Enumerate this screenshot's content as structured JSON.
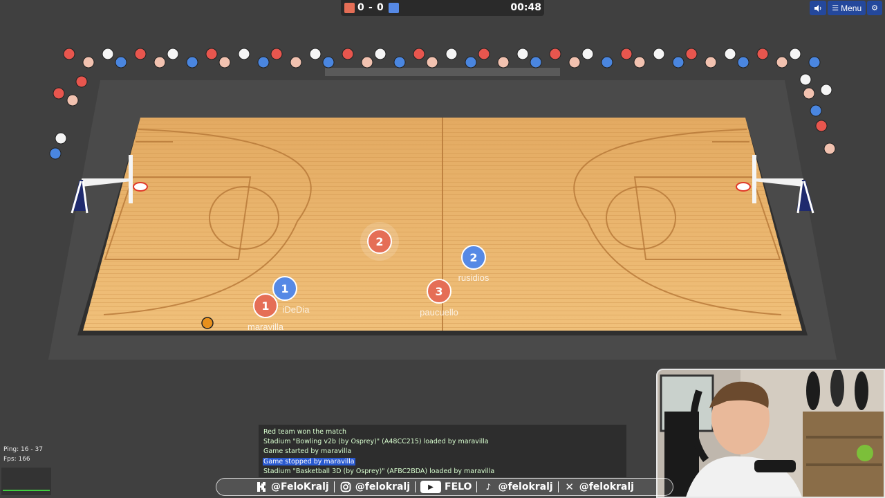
{
  "score": {
    "red": "0",
    "separator": "-",
    "blue": "0",
    "timer": "00:48"
  },
  "colors": {
    "red_team": "#e56e56",
    "blue_team": "#5689e5",
    "court": "#dfa45c",
    "chat_highlight": "#2a5ad0"
  },
  "toolbar": {
    "sound_icon": "speaker-icon",
    "menu_label": "Menu",
    "settings_icon": "gear-icon"
  },
  "players": [
    {
      "number": "2",
      "team": "red",
      "name": ""
    },
    {
      "number": "2",
      "team": "blue",
      "name": "rusidios"
    },
    {
      "number": "1",
      "team": "blue",
      "name": "iDeDia"
    },
    {
      "number": "1",
      "team": "red",
      "name": "maravilla"
    },
    {
      "number": "3",
      "team": "red",
      "name": "paucuello"
    }
  ],
  "chat": [
    "Red team won the match",
    "Stadium \"Bowling v2b (by Osprey)\" (A48CC215) loaded by maravilla",
    "Game started by maravilla",
    "Game stopped by maravilla",
    "Stadium \"Basketball 3D (by Osprey)\" (AFBC2BDA) loaded by maravilla"
  ],
  "stats": {
    "ping": "Ping: 16 - 37",
    "fps": "Fps: 166"
  },
  "social": [
    {
      "icon": "kick-icon",
      "handle": "@FeloKralj"
    },
    {
      "icon": "instagram-icon",
      "handle": "@felokralj"
    },
    {
      "icon": "youtube-icon",
      "handle": "FELO"
    },
    {
      "icon": "tiktok-icon",
      "handle": "@felokralj"
    },
    {
      "icon": "x-icon",
      "handle": "@felokralj"
    }
  ]
}
